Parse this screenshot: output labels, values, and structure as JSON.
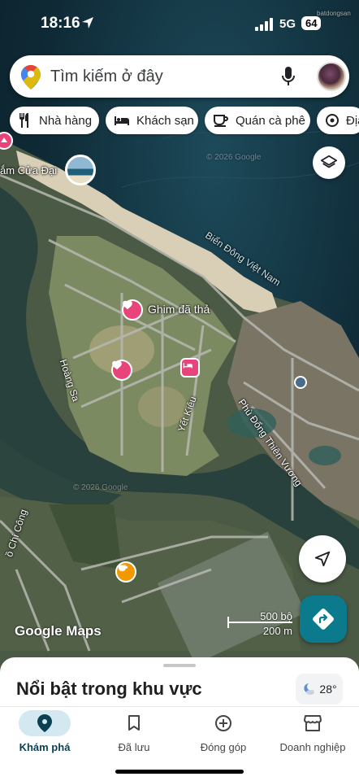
{
  "status_bar": {
    "time": "18:16",
    "network": "5G",
    "battery": "64"
  },
  "search": {
    "placeholder": "Tìm kiếm ở đây"
  },
  "chips": [
    {
      "label": "Nhà hàng",
      "icon": "restaurant-icon"
    },
    {
      "label": "Khách sạn",
      "icon": "hotel-icon"
    },
    {
      "label": "Quán cà phê",
      "icon": "coffee-icon"
    },
    {
      "label": "Địa",
      "icon": "attraction-icon"
    }
  ],
  "map": {
    "labels": {
      "beach": "ắm Cửa Đại",
      "sea": "Biển Đông Việt Nam",
      "pin": "Ghim đã thả",
      "hoang_sa": "Hoàng Sa",
      "yet_kieu": "Yết Kiêu",
      "phu_dong": "Phù Đổng Thiên Vương",
      "chi_cong": "ồ Chí Công",
      "watermark1": "© 2026 Google",
      "watermark2": "© 2026 Google"
    },
    "scale": {
      "imperial": "500 bộ",
      "metric": "200 m"
    },
    "google_logo": "Google Maps",
    "watermark_top": "batdongsan"
  },
  "sheet": {
    "title": "Nổi bật trong khu vực",
    "temperature": "28°"
  },
  "tabs": [
    {
      "label": "Khám phá",
      "icon": "explore-pin-icon",
      "active": true
    },
    {
      "label": "Đã lưu",
      "icon": "bookmark-icon",
      "active": false
    },
    {
      "label": "Đóng góp",
      "icon": "add-circle-icon",
      "active": false
    },
    {
      "label": "Doanh nghiệp",
      "icon": "storefront-icon",
      "active": false
    }
  ],
  "colors": {
    "accent": "#0b7a8c",
    "pin_pink": "#e8437a",
    "active_tab": "#d3e8f0"
  }
}
